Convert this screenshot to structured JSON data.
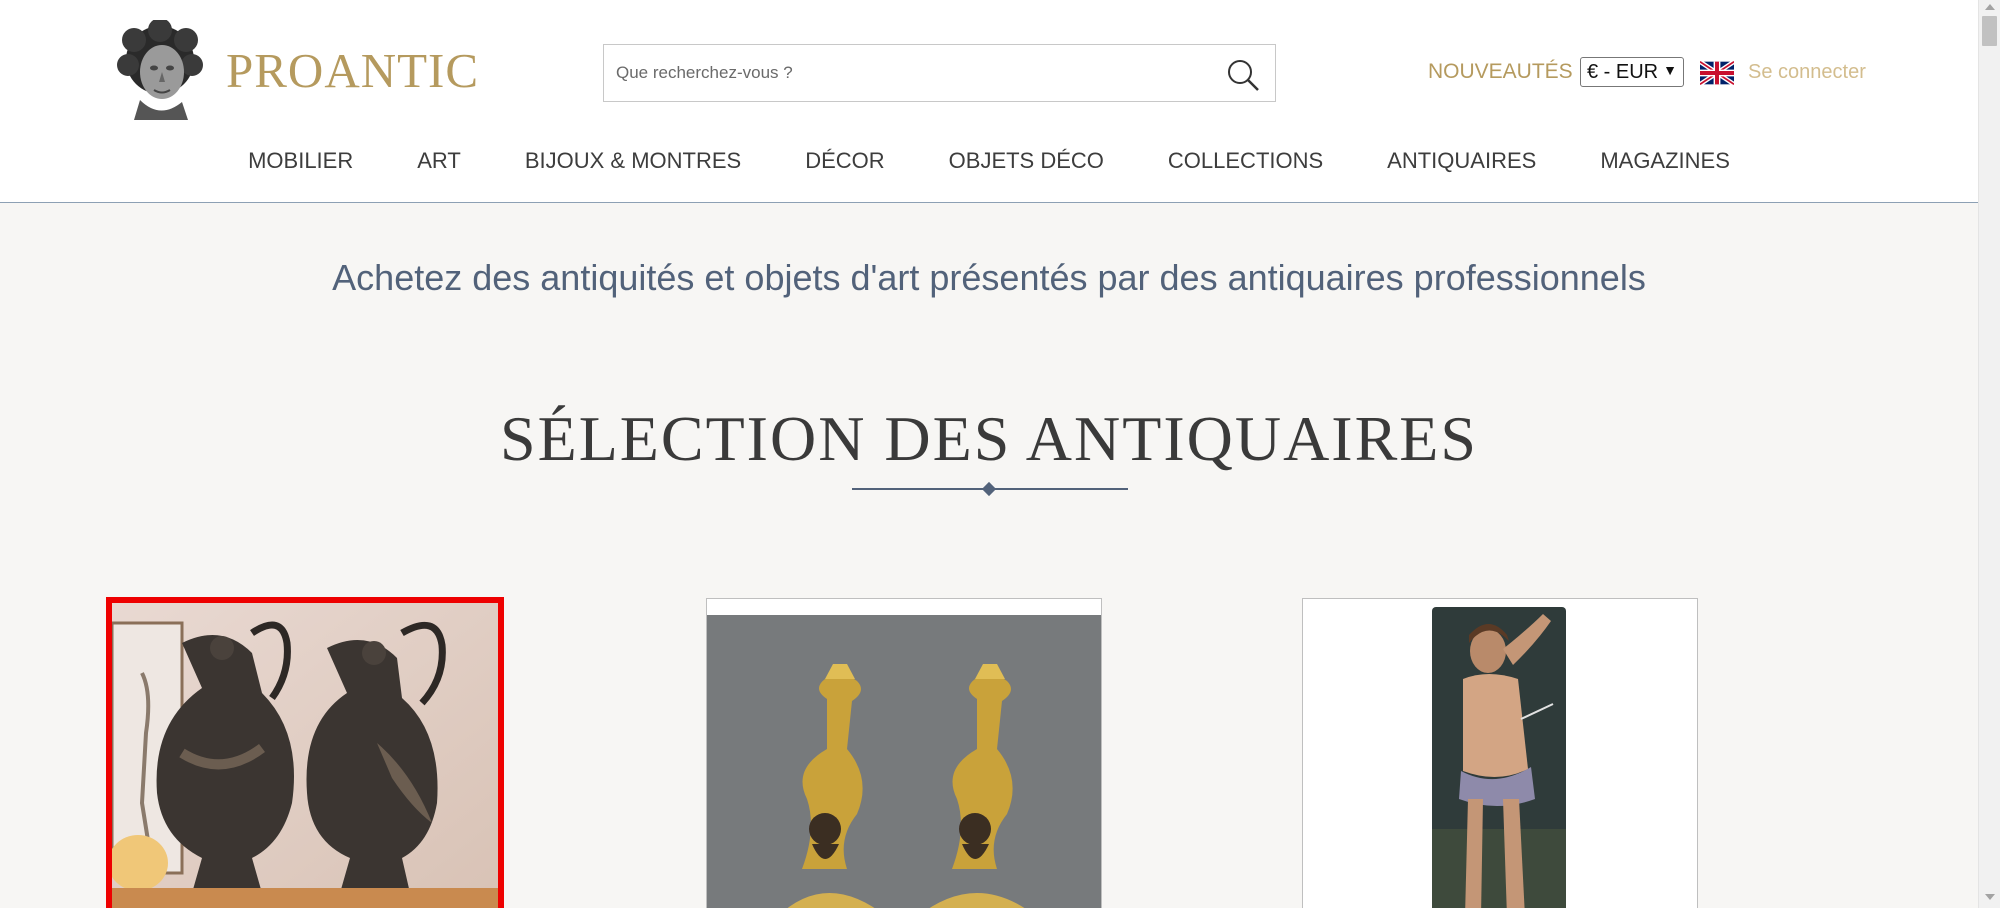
{
  "site": {
    "logo_text": "PROANTIC"
  },
  "search": {
    "placeholder": "Que recherchez-vous ?"
  },
  "header": {
    "nouveautes": "NOUVEAUTÉS",
    "currency": "€ - EUR",
    "login": "Se connecter"
  },
  "nav": [
    "MOBILIER",
    "ART",
    "BIJOUX & MONTRES",
    "DÉCOR",
    "OBJETS DÉCO",
    "COLLECTIONS",
    "ANTIQUAIRES",
    "MAGAZINES"
  ],
  "main": {
    "tagline": "Achetez des antiquités et objets d'art présentés par des antiquaires professionnels",
    "section_title": "SÉLECTION DES ANTIQUAIRES"
  },
  "colors": {
    "gold": "#b59a5e",
    "slate": "#52627a",
    "selected_border": "#ee0000"
  }
}
